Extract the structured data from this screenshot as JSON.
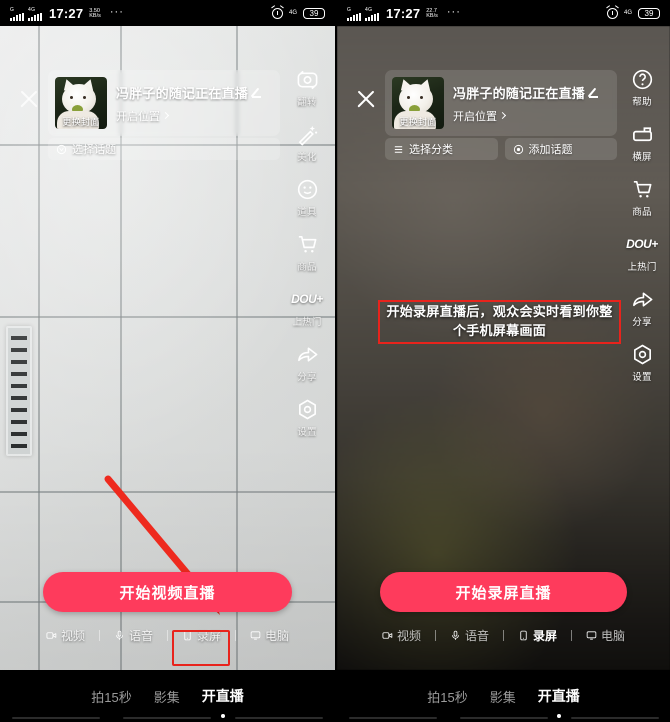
{
  "panels": [
    {
      "id": "video-live-panel",
      "status": {
        "carrier_badge": "G",
        "net_badge": "4G",
        "time": "17:27",
        "rate_value": "3.50",
        "rate_unit": "KB/s",
        "overflow": "···",
        "battery": "39"
      },
      "close_label": "×",
      "card": {
        "cover_label": "更换封面",
        "title": "冯胖子的随记正在直播",
        "location": "开启位置"
      },
      "chips": [
        {
          "icon": "topic-icon",
          "label": "选择话题"
        }
      ],
      "rail": [
        {
          "icon": "flip-camera-icon",
          "label": "翻转"
        },
        {
          "icon": "magic-wand-icon",
          "label": "美化"
        },
        {
          "icon": "smiley-props-icon",
          "label": "道具"
        },
        {
          "icon": "shopping-cart-icon",
          "label": "商品"
        },
        {
          "icon": "dou-plus-icon",
          "label": "上热门"
        },
        {
          "icon": "share-arrow-icon",
          "label": "分享"
        },
        {
          "icon": "settings-gear-icon",
          "label": "设置"
        }
      ],
      "primary_button": "开始视频直播",
      "modes": [
        {
          "icon": "video-camera-icon",
          "label": "视频",
          "active": false
        },
        {
          "icon": "microphone-icon",
          "label": "语音",
          "active": false
        },
        {
          "icon": "phone-screen-icon",
          "label": "录屏",
          "active": false
        },
        {
          "icon": "desktop-monitor-icon",
          "label": "电脑",
          "active": false
        }
      ],
      "highlight_mode_index": 2,
      "annotation_arrow": true,
      "bottom_nav": [
        {
          "label": "拍15秒",
          "active": false
        },
        {
          "label": "影集",
          "active": false
        },
        {
          "label": "开直播",
          "active": true
        }
      ]
    },
    {
      "id": "screen-record-live-panel",
      "status": {
        "carrier_badge": "G",
        "net_badge": "4G",
        "time": "17:27",
        "rate_value": "22.7",
        "rate_unit": "KB/s",
        "overflow": "···",
        "battery": "39"
      },
      "close_label": "×",
      "card": {
        "cover_label": "更换封面",
        "title": "冯胖子的随记正在直播",
        "location": "开启位置"
      },
      "chips": [
        {
          "icon": "category-list-icon",
          "label": "选择分类"
        },
        {
          "icon": "topic-icon",
          "label": "添加话题"
        }
      ],
      "rail": [
        {
          "icon": "help-question-icon",
          "label": "帮助"
        },
        {
          "icon": "landscape-rotate-icon",
          "label": "横屏"
        },
        {
          "icon": "shopping-cart-icon",
          "label": "商品"
        },
        {
          "icon": "dou-plus-icon",
          "label": "上热门"
        },
        {
          "icon": "share-arrow-icon",
          "label": "分享"
        },
        {
          "icon": "settings-gear-icon",
          "label": "设置"
        }
      ],
      "primary_button": "开始录屏直播",
      "modes": [
        {
          "icon": "video-camera-icon",
          "label": "视频",
          "active": false
        },
        {
          "icon": "microphone-icon",
          "label": "语音",
          "active": false
        },
        {
          "icon": "phone-screen-icon",
          "label": "录屏",
          "active": true
        },
        {
          "icon": "desktop-monitor-icon",
          "label": "电脑",
          "active": false
        }
      ],
      "annotation_text": "开始录屏直播后，观众会实时看到你整个手机屏幕画面",
      "bottom_nav": [
        {
          "label": "拍15秒",
          "active": false
        },
        {
          "label": "影集",
          "active": false
        },
        {
          "label": "开直播",
          "active": true
        }
      ]
    }
  ],
  "colors": {
    "accent_pink": "#fe3b5c",
    "annotation_red": "#e8231c",
    "status_bar_bg": "#000000"
  }
}
